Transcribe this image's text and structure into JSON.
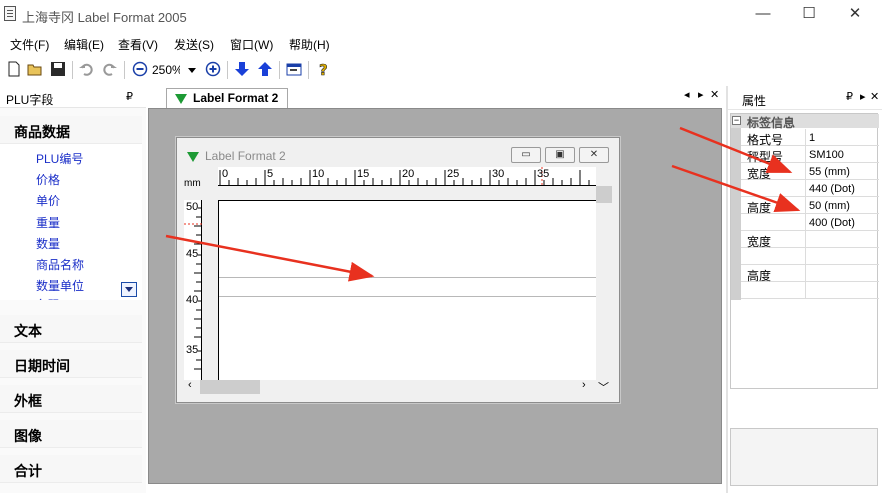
{
  "window": {
    "title": "上海寺冈 Label Format 2005",
    "minimize": "—",
    "maximize": "☐",
    "close": "✕"
  },
  "menu": [
    "文件(F)",
    "编辑(E)",
    "查看(V)",
    "发送(S)",
    "窗口(W)",
    "帮助(H)"
  ],
  "toolbar": {
    "zoom": "250%"
  },
  "left_panel": {
    "title": "PLU字段",
    "pin": "₽",
    "categories": {
      "product_data": "商品数据",
      "text": "文本",
      "datetime": "日期时间",
      "frame": "外框",
      "image": "图像",
      "total": "合计"
    },
    "items": [
      "PLU编号",
      "价格",
      "单价",
      "重量",
      "数量",
      "商品名称",
      "数量单位",
      "条码"
    ]
  },
  "document": {
    "tab_label": "Label Format 2",
    "tab_ctrl": [
      "◂",
      "▸",
      "✕"
    ],
    "mdi_title": "Label Format 2",
    "ruler_unit": "mm",
    "ruler_top_labels": [
      "0",
      "5",
      "10",
      "15",
      "20",
      "25",
      "30",
      "35"
    ],
    "ruler_left_labels": [
      "50",
      "45",
      "40",
      "35"
    ]
  },
  "properties": {
    "title": "属性",
    "section": "标签信息",
    "rows": [
      {
        "key": "格式号",
        "value": "1"
      },
      {
        "key": "秤型号",
        "value": "SM100"
      },
      {
        "key": "宽度",
        "value": "55 (mm)"
      },
      {
        "key": "",
        "value": "440 (Dot)"
      },
      {
        "key": "高度",
        "value": "50 (mm)"
      },
      {
        "key": "",
        "value": "400 (Dot)"
      },
      {
        "key": "宽度",
        "value": ""
      },
      {
        "key": "",
        "value": ""
      },
      {
        "key": "高度",
        "value": ""
      },
      {
        "key": "",
        "value": ""
      }
    ]
  },
  "colors": {
    "accent_arrow": "#e8311f",
    "link_blue": "#1a2ec8",
    "workspace_gray": "#a9a9a9",
    "tab_green": "#1d9a35"
  }
}
